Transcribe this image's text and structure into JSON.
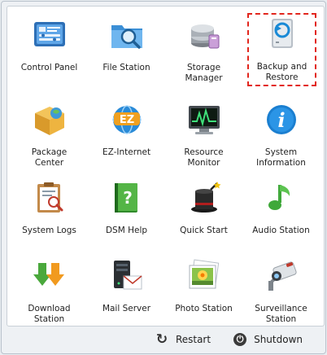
{
  "apps": [
    {
      "name": "control-panel",
      "label": "Control Panel",
      "icon": "control-panel-icon"
    },
    {
      "name": "file-station",
      "label": "File Station",
      "icon": "folder-search-icon"
    },
    {
      "name": "storage-manager",
      "label": "Storage\nManager",
      "icon": "disk-stack-icon"
    },
    {
      "name": "backup-and-restore",
      "label": "Backup and\nRestore",
      "icon": "backup-drive-icon",
      "highlighted": true
    },
    {
      "name": "package-center",
      "label": "Package\nCenter",
      "icon": "package-box-icon"
    },
    {
      "name": "ez-internet",
      "label": "EZ-Internet",
      "icon": "ez-globe-icon"
    },
    {
      "name": "resource-monitor",
      "label": "Resource\nMonitor",
      "icon": "monitor-graph-icon"
    },
    {
      "name": "system-information",
      "label": "System\nInformation",
      "icon": "info-icon"
    },
    {
      "name": "system-logs",
      "label": "System Logs",
      "icon": "log-clipboard-icon"
    },
    {
      "name": "dsm-help",
      "label": "DSM Help",
      "icon": "help-book-icon"
    },
    {
      "name": "quick-start",
      "label": "Quick Start",
      "icon": "magic-hat-icon"
    },
    {
      "name": "audio-station",
      "label": "Audio Station",
      "icon": "music-note-icon"
    },
    {
      "name": "download-station",
      "label": "Download\nStation",
      "icon": "download-arrows-icon"
    },
    {
      "name": "mail-server",
      "label": "Mail Server",
      "icon": "mail-server-icon"
    },
    {
      "name": "photo-station",
      "label": "Photo Station",
      "icon": "photo-frame-icon"
    },
    {
      "name": "surveillance-station",
      "label": "Surveillance\nStation",
      "icon": "security-camera-icon"
    }
  ],
  "footer": {
    "restart_label": "Restart",
    "shutdown_label": "Shutdown"
  },
  "colors": {
    "highlight_border": "#e2261d",
    "panel_background": "#ffffff"
  }
}
